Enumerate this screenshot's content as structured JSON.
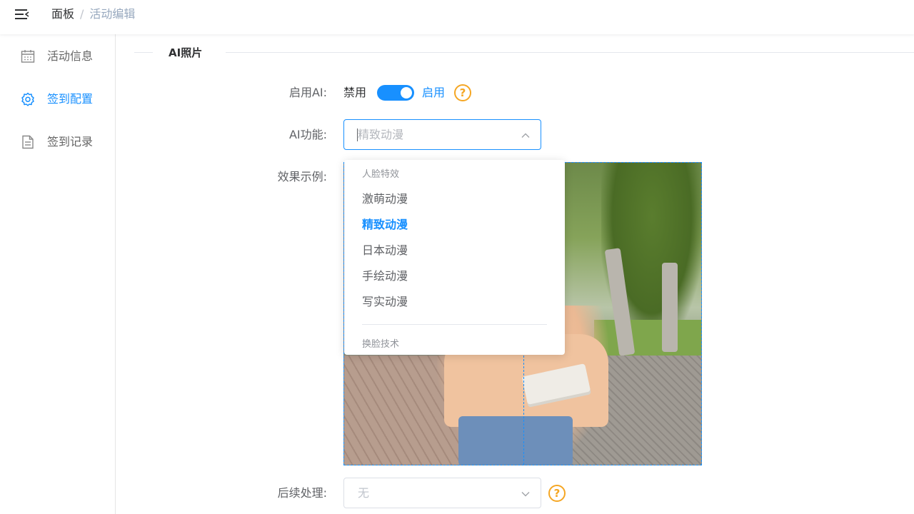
{
  "header": {
    "breadcrumb": [
      "面板",
      "活动编辑"
    ],
    "separator": "/"
  },
  "sidebar": {
    "items": [
      {
        "label": "活动信息",
        "icon": "calendar-icon",
        "active": false
      },
      {
        "label": "签到配置",
        "icon": "gear-icon",
        "active": true
      },
      {
        "label": "签到记录",
        "icon": "document-icon",
        "active": false
      }
    ]
  },
  "section": {
    "title": "AI照片"
  },
  "form": {
    "enable_ai": {
      "label": "启用AI:",
      "off_text": "禁用",
      "on_text": "启用",
      "value": true,
      "help": "?"
    },
    "ai_function": {
      "label": "AI功能:",
      "value": "精致动漫"
    },
    "example": {
      "label": "效果示例:"
    },
    "post_process": {
      "label": "后续处理:",
      "value": "无",
      "help": "?"
    }
  },
  "dropdown": {
    "group1": "人脸特效",
    "items": [
      "激萌动漫",
      "精致动漫",
      "日本动漫",
      "手绘动漫",
      "写实动漫"
    ],
    "selected": "精致动漫",
    "group2": "换脸技术"
  },
  "colors": {
    "accent": "#1890ff",
    "help": "#f5a623",
    "border": "#dcdfe6"
  }
}
